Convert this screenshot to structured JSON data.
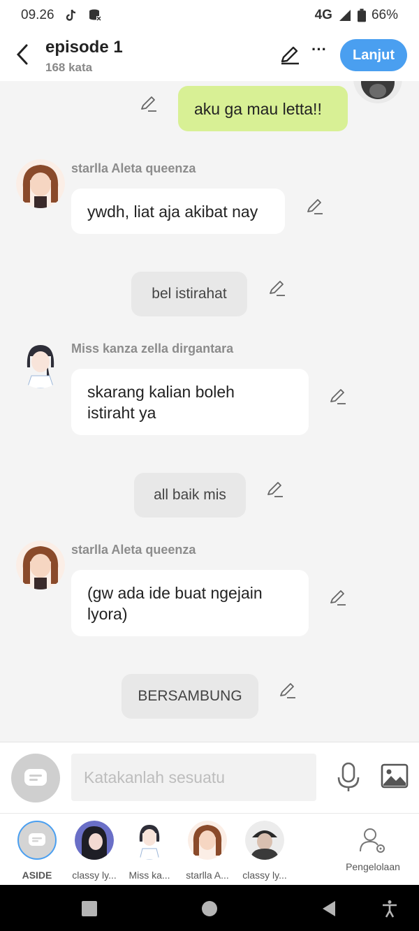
{
  "status_bar": {
    "time": "09.26",
    "network": "4G",
    "battery": "66%"
  },
  "header": {
    "title": "episode 1",
    "word_count": "168 kata",
    "next_label": "Lanjut"
  },
  "messages": [
    {
      "type": "me",
      "text": "aku ga mau letta!!"
    },
    {
      "type": "char",
      "sender": "starlla Aleta queenza",
      "text": "ywdh, liat aja akibat nay"
    },
    {
      "type": "narration",
      "text": "bel istirahat"
    },
    {
      "type": "char",
      "sender": "Miss kanza zella dirgantara",
      "text_line1": "skarang kalian boleh",
      "text_line2": "istiraht ya"
    },
    {
      "type": "narration",
      "text": "all baik mis"
    },
    {
      "type": "char",
      "sender": "starlla Aleta queenza",
      "text_line1": "(gw ada ide buat ngejain",
      "text_line2": "lyora)"
    },
    {
      "type": "narration",
      "text": "BERSAMBUNG"
    }
  ],
  "input": {
    "placeholder": "Katakanlah sesuatu"
  },
  "characters": [
    {
      "label": "ASIDE"
    },
    {
      "label": "classy ly..."
    },
    {
      "label": "Miss ka..."
    },
    {
      "label": "starlla A..."
    },
    {
      "label": "classy ly..."
    },
    {
      "label": "Pengelolaan"
    }
  ],
  "colors": {
    "accent": "#4a9ff0",
    "my_bubble": "#d8f095",
    "chat_bg": "#f4f4f4"
  }
}
